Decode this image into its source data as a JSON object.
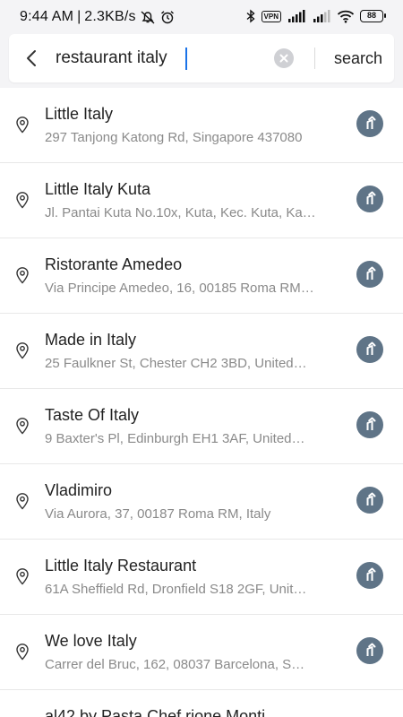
{
  "status_bar": {
    "time": "9:44 AM",
    "speed": "2.3KB/s",
    "vpn": "VPN",
    "battery": "88"
  },
  "search": {
    "value": "restaurant italy",
    "button_label": "search"
  },
  "results": [
    {
      "title": "Little Italy",
      "address": "297 Tanjong Katong Rd, Singapore 437080"
    },
    {
      "title": "Little Italy Kuta",
      "address": "Jl. Pantai Kuta No.10x, Kuta, Kec. Kuta, Ka…"
    },
    {
      "title": "Ristorante Amedeo",
      "address": "Via Principe Amedeo, 16, 00185 Roma RM…"
    },
    {
      "title": "Made in Italy",
      "address": "25 Faulkner St, Chester CH2 3BD, United…"
    },
    {
      "title": "Taste Of Italy",
      "address": "9 Baxter's Pl, Edinburgh EH1 3AF, United…"
    },
    {
      "title": "Vladimiro",
      "address": "Via Aurora, 37, 00187 Roma RM, Italy"
    },
    {
      "title": "Little Italy Restaurant",
      "address": "61A Sheffield Rd, Dronfield S18 2GF, Unit…"
    },
    {
      "title": "We love Italy",
      "address": "Carrer del Bruc, 162, 08037 Barcelona, S…"
    },
    {
      "title": "al42 by Pasta Chef rione Monti",
      "address": ""
    }
  ]
}
